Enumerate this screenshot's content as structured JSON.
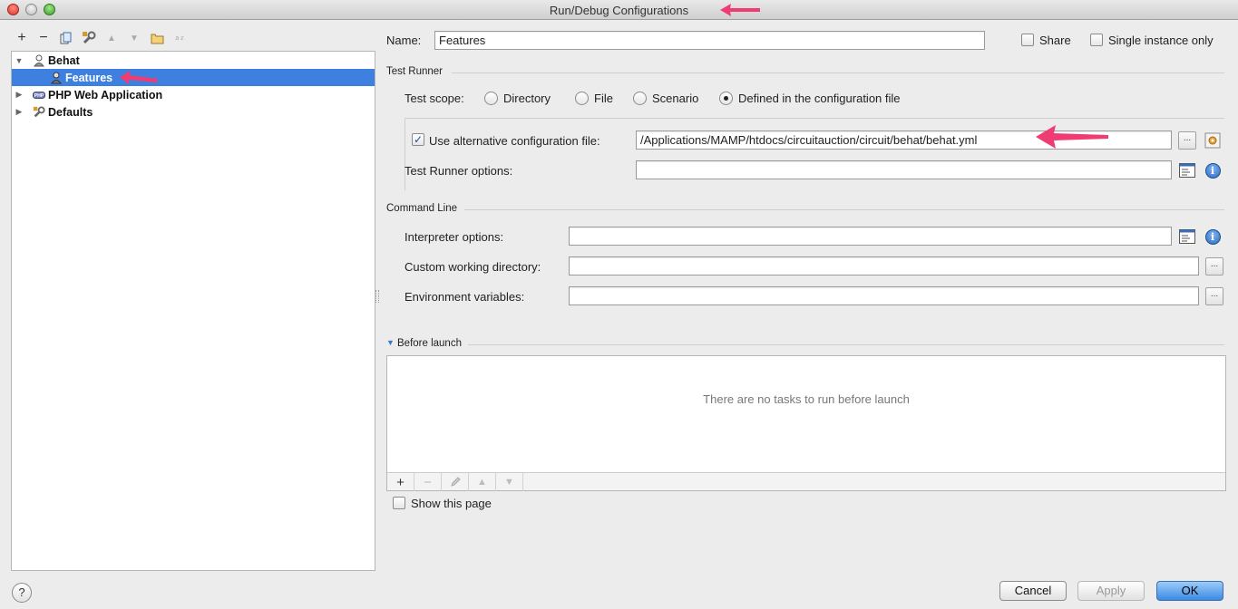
{
  "window": {
    "title": "Run/Debug Configurations"
  },
  "left_toolbar": {
    "add": "+",
    "remove": "−",
    "sort_label": "a z"
  },
  "tree": {
    "items": [
      {
        "label": "Behat",
        "expanded": true,
        "icon": "behat-icon"
      },
      {
        "label": "Features",
        "selected": true,
        "icon": "behat-config-icon"
      },
      {
        "label": "PHP Web Application",
        "expanded": false,
        "icon": "php-icon"
      },
      {
        "label": "Defaults",
        "expanded": false,
        "icon": "wrench-icon"
      }
    ]
  },
  "form": {
    "name_label": "Name:",
    "name_value": "Features",
    "share_label": "Share",
    "single_instance_label": "Single instance only",
    "test_runner_section": "Test Runner",
    "test_scope_label": "Test scope:",
    "scope_options": [
      "Directory",
      "File",
      "Scenario",
      "Defined in the configuration file"
    ],
    "scope_selected": "Defined in the configuration file",
    "alt_config_label": "Use alternative configuration file:",
    "alt_config_checked": true,
    "alt_config_value": "/Applications/MAMP/htdocs/circuitauction/circuit/behat/behat.yml",
    "runner_options_label": "Test Runner options:",
    "runner_options_value": "",
    "command_line_section": "Command Line",
    "interpreter_label": "Interpreter options:",
    "interpreter_value": "",
    "working_dir_label": "Custom working directory:",
    "working_dir_value": "",
    "env_label": "Environment variables:",
    "env_value": "",
    "browse_label": "...",
    "info_label": "i"
  },
  "before_launch": {
    "title": "Before launch",
    "empty_text": "There are no tasks to run before launch",
    "add": "+",
    "remove": "−",
    "show_page_label": "Show this page"
  },
  "footer": {
    "help": "?",
    "cancel": "Cancel",
    "apply": "Apply",
    "ok": "OK"
  },
  "colors": {
    "selection": "#3d80df",
    "annotation_arrow": "#ef3d74",
    "default_button": "#3c8ae4"
  }
}
